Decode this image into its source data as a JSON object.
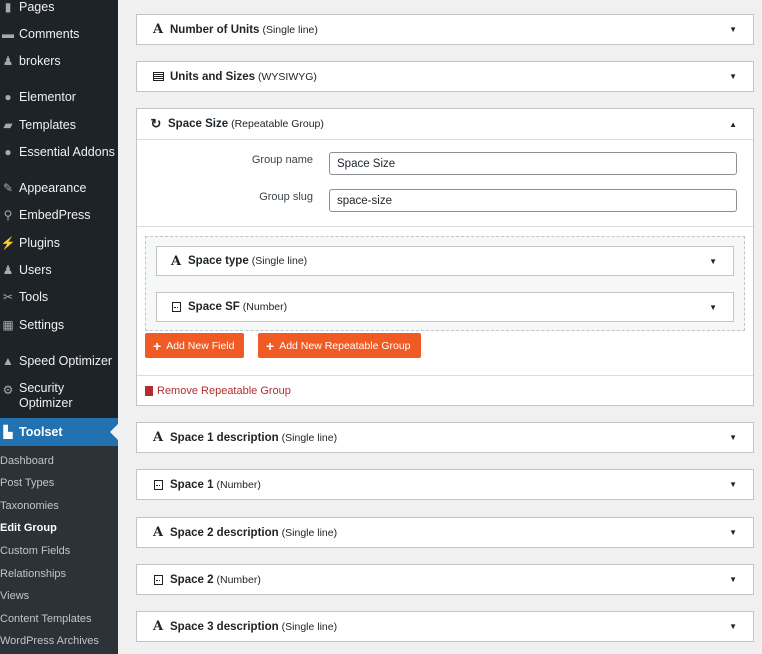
{
  "sidebar": {
    "items": [
      {
        "label": "Pages",
        "icon": "pages-icon"
      },
      {
        "label": "Comments",
        "icon": "comments-icon"
      },
      {
        "label": "brokers",
        "icon": "brokers-icon"
      },
      {
        "label": "Elementor",
        "icon": "elementor-icon"
      },
      {
        "label": "Templates",
        "icon": "templates-icon"
      },
      {
        "label": "Essential Addons",
        "icon": "essential-addons-icon"
      },
      {
        "label": "Appearance",
        "icon": "appearance-icon"
      },
      {
        "label": "EmbedPress",
        "icon": "embedpress-icon"
      },
      {
        "label": "Plugins",
        "icon": "plugins-icon"
      },
      {
        "label": "Users",
        "icon": "users-icon"
      },
      {
        "label": "Tools",
        "icon": "tools-icon"
      },
      {
        "label": "Settings",
        "icon": "settings-icon"
      },
      {
        "label": "Speed Optimizer",
        "icon": "speed-optimizer-icon"
      },
      {
        "label": "Security Optimizer",
        "icon": "security-optimizer-icon"
      },
      {
        "label": "Toolset",
        "icon": "toolset-icon"
      }
    ],
    "submenu": [
      "Dashboard",
      "Post Types",
      "Taxonomies",
      "Edit Group",
      "Custom Fields",
      "Relationships",
      "Views",
      "Content Templates",
      "WordPress Archives"
    ],
    "active_submenu": "Edit Group",
    "accent": "#2271b1"
  },
  "fields_top": [
    {
      "name": "Number of Units",
      "type": "(Single line)",
      "icon": "text-a-icon"
    },
    {
      "name": "Units and Sizes",
      "type": "(WYSIWYG)",
      "icon": "wysiwyg-icon"
    }
  ],
  "group": {
    "name": "Space Size",
    "type": "(Repeatable Group)",
    "icon": "repeat-icon",
    "group_name_label": "Group name",
    "group_name_value": "Space Size",
    "group_slug_label": "Group slug",
    "group_slug_value": "space-size",
    "inner_fields": [
      {
        "name": "Space type",
        "type": "(Single line)",
        "icon": "text-a-icon"
      },
      {
        "name": "Space SF",
        "type": "(Number)",
        "icon": "number-icon"
      }
    ],
    "add_field_label": "Add New Field",
    "add_group_label": "Add New Repeatable Group",
    "remove_label": "Remove Repeatable Group",
    "button_color": "#f05a24",
    "remove_color": "#b32d2e"
  },
  "fields_bottom": [
    {
      "name": "Space 1 description",
      "type": "(Single line)",
      "icon": "text-a-icon"
    },
    {
      "name": "Space 1",
      "type": "(Number)",
      "icon": "number-icon"
    },
    {
      "name": "Space 2 description",
      "type": "(Single line)",
      "icon": "text-a-icon"
    },
    {
      "name": "Space 2",
      "type": "(Number)",
      "icon": "number-icon"
    },
    {
      "name": "Space 3 description",
      "type": "(Single line)",
      "icon": "text-a-icon"
    }
  ]
}
